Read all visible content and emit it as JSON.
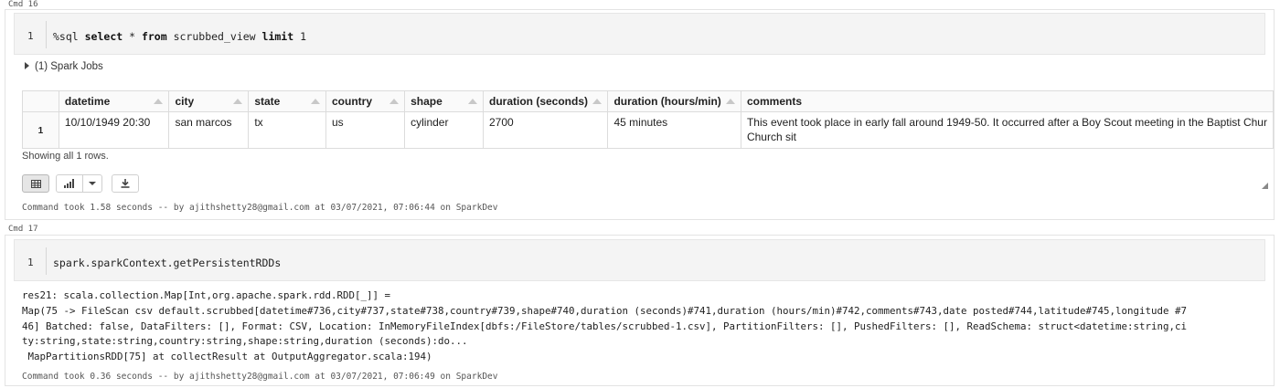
{
  "cells": [
    {
      "label": "Cmd 16",
      "line_number": "1",
      "code_parts": {
        "magic": "%sql ",
        "kw_select": "select",
        "star": " * ",
        "kw_from": "from",
        "table": " scrubbed_view ",
        "kw_limit": "limit",
        "num": " 1"
      },
      "spark_jobs": "(1) Spark Jobs",
      "table": {
        "headers": [
          "",
          "datetime",
          "city",
          "state",
          "country",
          "shape",
          "duration (seconds)",
          "duration (hours/min)",
          "comments"
        ],
        "rows": [
          {
            "row_number": "1",
            "values": [
              "10/10/1949 20:30",
              "san marcos",
              "tx",
              "us",
              "cylinder",
              "2700",
              "45 minutes"
            ],
            "comment_line1": "This event took place in early fall around 1949-50. It occurred after a Boy Scout meeting in the Baptist Chur",
            "comment_line2": "Church sit"
          }
        ]
      },
      "showing": "Showing all 1 rows.",
      "toolbar": {
        "table_icon": "table-icon",
        "chart_icon": "bar-chart-icon",
        "dropdown_icon": "chevron-down-icon",
        "download_icon": "download-icon"
      },
      "took": "Command took 1.58 seconds -- by ajithshetty28@gmail.com at 03/07/2021, 07:06:44 on SparkDev"
    },
    {
      "label": "Cmd 17",
      "line_number": "1",
      "code": "spark.sparkContext.getPersistentRDDs",
      "output_lines": [
        "res21: scala.collection.Map[Int,org.apache.spark.rdd.RDD[_]] =",
        "Map(75 -> FileScan csv default.scrubbed[datetime#736,city#737,state#738,country#739,shape#740,duration (seconds)#741,duration (hours/min)#742,comments#743,date posted#744,latitude#745,longitude #7",
        "46] Batched: false, DataFilters: [], Format: CSV, Location: InMemoryFileIndex[dbfs:/FileStore/tables/scrubbed-1.csv], PartitionFilters: [], PushedFilters: [], ReadSchema: struct<datetime:string,ci",
        "ty:string,state:string,country:string,shape:string,duration (seconds):do...",
        " MapPartitionsRDD[75] at collectResult at OutputAggregator.scala:194)"
      ],
      "took": "Command took 0.36 seconds -- by ajithshetty28@gmail.com at 03/07/2021, 07:06:49 on SparkDev"
    }
  ]
}
